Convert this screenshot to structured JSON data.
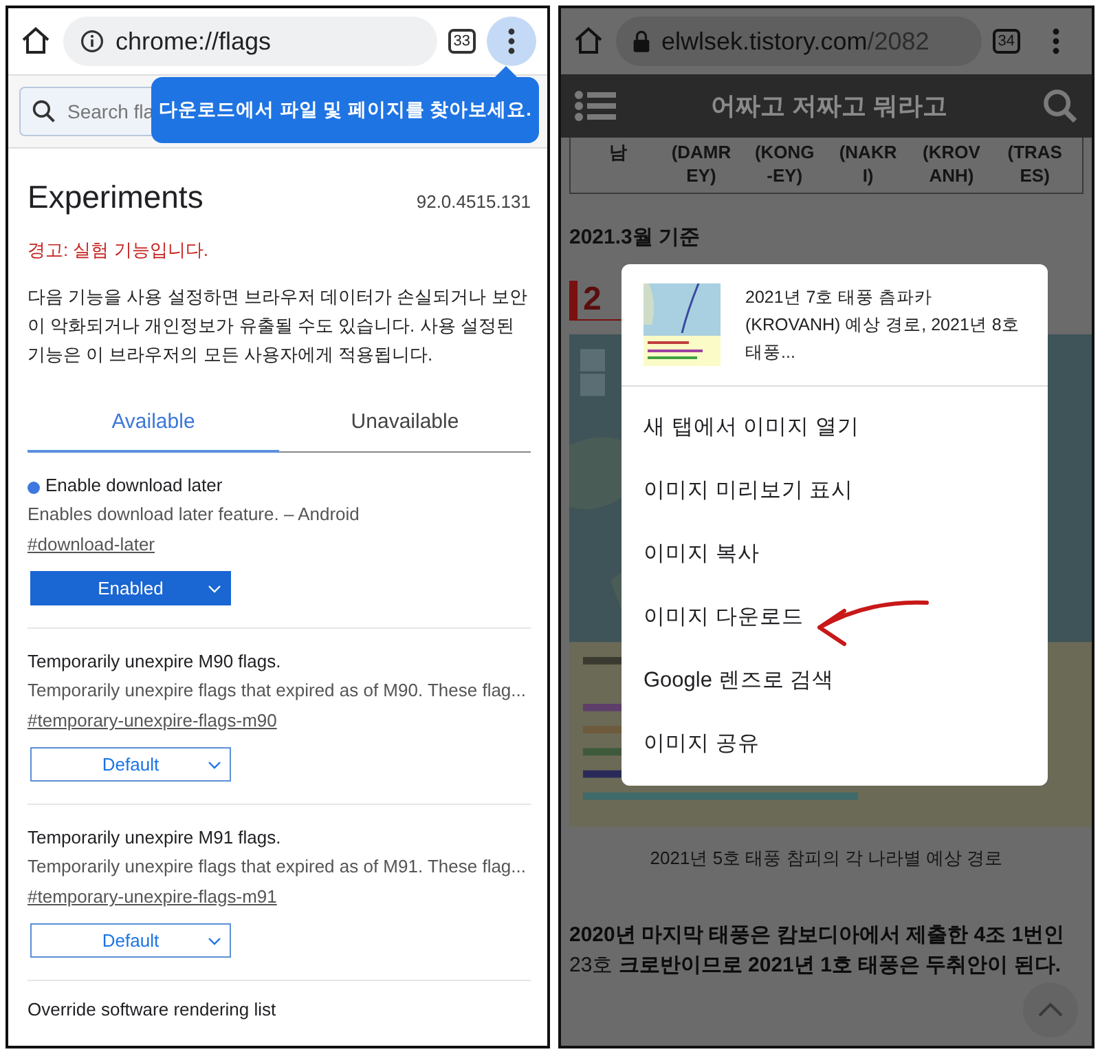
{
  "left_screen": {
    "toolbar": {
      "url": "chrome://flags",
      "tab_count": "33"
    },
    "tooltip": "다운로드에서 파일 및 페이지를 찾아보세요.",
    "search": {
      "placeholder": "Search fla"
    },
    "title": "Experiments",
    "version": "92.0.4515.131",
    "warning": "경고: 실험 기능입니다.",
    "description": "다음 기능을 사용 설정하면 브라우저 데이터가 손실되거나 보안이 악화되거나 개인정보가 유출될 수도 있습니다. 사용 설정된 기능은 이 브라우저의 모든 사용자에게 적용됩니다.",
    "tabs": [
      {
        "label": "Available",
        "selected": true
      },
      {
        "label": "Unavailable",
        "selected": false
      }
    ],
    "flags": [
      {
        "name": "Enable download later",
        "modified": true,
        "description": "Enables download later feature. – Android",
        "link": "#download-later",
        "value": "Enabled"
      },
      {
        "name": "Temporarily unexpire M90 flags.",
        "modified": false,
        "description": "Temporarily unexpire flags that expired as of M90. These flag...",
        "link": "#temporary-unexpire-flags-m90",
        "value": "Default"
      },
      {
        "name": "Temporarily unexpire M91 flags.",
        "modified": false,
        "description": "Temporarily unexpire flags that expired as of M91. These flag...",
        "link": "#temporary-unexpire-flags-m91",
        "value": "Default"
      }
    ],
    "cut_off_flag": "Override software rendering list"
  },
  "right_screen": {
    "toolbar": {
      "domain": "elwlsek.tistory.com",
      "path": "/2082",
      "tab_count": "34"
    },
    "blog_title": "어짜고 저짜고 뭐라고",
    "table_row": [
      "남",
      "(DAMREY)",
      "(KONG-EY)",
      "(NAKRI)",
      "(KROVANH)",
      "(TRASES)"
    ],
    "date_note": "2021.3월 기준",
    "heading": "2",
    "caption": "2021년 5호 태풍 참피의 각 나라별 예상 경로",
    "paragraph": "**2020년 마지막 태풍은 캄보디아에서 제출한 4조 1번인** 23호 **크로반이므로 2021년 1호 태풍은 두취안이 된다.**",
    "context_menu": {
      "title": "2021년 7호 태풍 츰파카(KROVANH) 예상 경로, 2021년 8호 태풍...",
      "items": [
        {
          "label": "새 탭에서 이미지 열기",
          "highlighted": false
        },
        {
          "label": "이미지 미리보기 표시",
          "highlighted": false
        },
        {
          "label": "이미지 복사",
          "highlighted": false
        },
        {
          "label": "이미지 다운로드",
          "highlighted": true
        },
        {
          "label": "Google 렌즈로 검색",
          "highlighted": false
        },
        {
          "label": "이미지 공유",
          "highlighted": false
        }
      ]
    }
  }
}
